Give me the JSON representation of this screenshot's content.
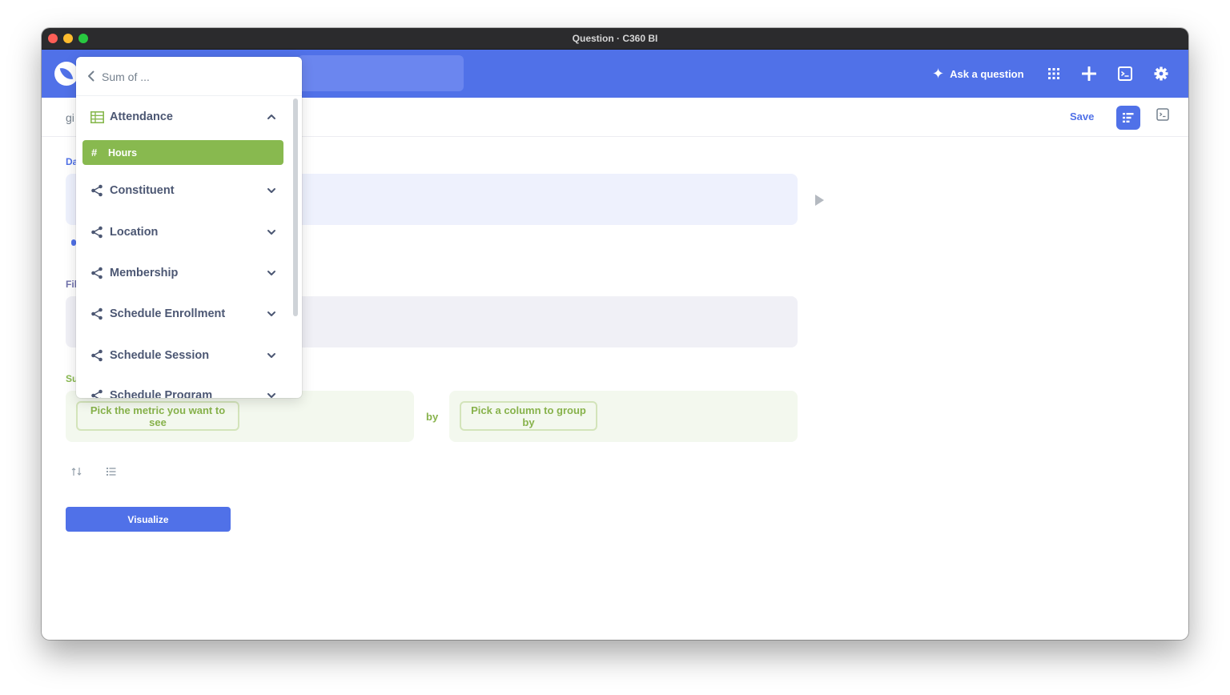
{
  "window": {
    "title": "Question · C360 BI"
  },
  "appbar": {
    "ask_label": "Ask a question",
    "icons": [
      "grid-icon",
      "plus-icon",
      "sql-editor-icon",
      "gear-icon"
    ]
  },
  "subheader": {
    "breadcrumb_fragment": "gi",
    "save_label": "Save"
  },
  "editor": {
    "data_label_fragment": "Da",
    "filter_label_fragment": "Fil",
    "summarize_label_fragment": "Su",
    "metric_placeholder": "Pick the metric you want to see",
    "by_label": "by",
    "groupby_placeholder": "Pick a column to group by",
    "visualize_label": "Visualize"
  },
  "popover": {
    "title": "Sum of ...",
    "sections": [
      {
        "label": "Attendance",
        "icon": "table-icon",
        "expanded": true
      },
      {
        "label": "Constituent",
        "icon": "connections-icon",
        "expanded": false
      },
      {
        "label": "Location",
        "icon": "connections-icon",
        "expanded": false
      },
      {
        "label": "Membership",
        "icon": "connections-icon",
        "expanded": false
      },
      {
        "label": "Schedule Enrollment",
        "icon": "connections-icon",
        "expanded": false
      },
      {
        "label": "Schedule Session",
        "icon": "connections-icon",
        "expanded": false
      },
      {
        "label": "Schedule Program",
        "icon": "connections-icon",
        "expanded": false
      }
    ],
    "selected_field": {
      "symbol": "#",
      "label": "Hours"
    }
  },
  "colors": {
    "brand": "#5071e8",
    "summarize_green": "#88b94f",
    "text_dark": "#4c5773"
  }
}
